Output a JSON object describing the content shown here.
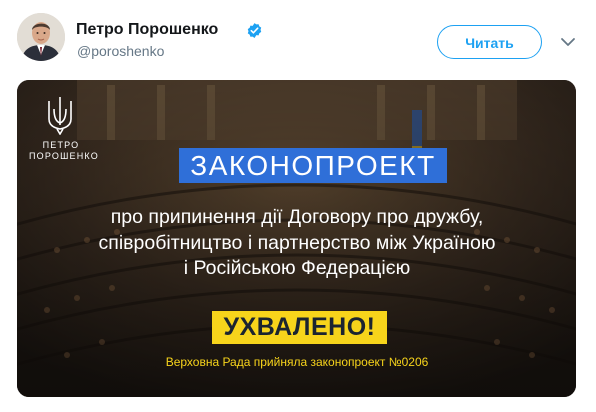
{
  "author": {
    "name": "Петро Порошенко",
    "handle": "@poroshenko",
    "verified": true
  },
  "actions": {
    "follow_label": "Читать",
    "menu_icon": "chevron-down-icon"
  },
  "media": {
    "logo_text": "ПЕТРО ПОРОШЕНКО",
    "title": "ЗАКОНОПРОЕКТ",
    "description_lines": [
      "про припинення дії Договору про дружбу,",
      "співробітництво і партнерство між Україною",
      "і Російською Федерацією"
    ],
    "status": "УХВАЛЕНО!",
    "footnote": "Верховна Рада прийняла законопроект №0206"
  },
  "colors": {
    "accent": "#1da1f2",
    "title_badge": "#2f6fd8",
    "status_badge": "#f7d41b",
    "footnote": "#f7d41b"
  }
}
